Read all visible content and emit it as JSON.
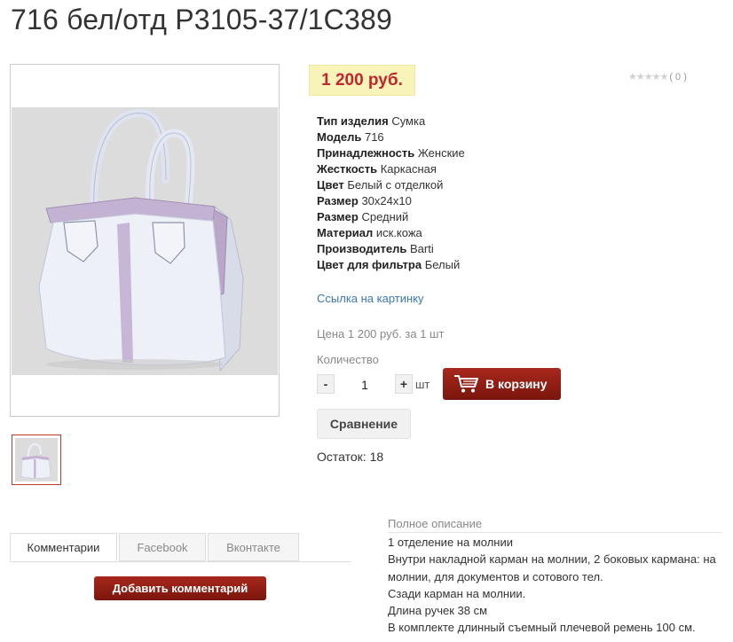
{
  "product": {
    "title": "716 бел/отд Р3105-37/1С389",
    "price": "1 200 руб.",
    "rating": {
      "count_text": "( 0 )",
      "stars": 0
    }
  },
  "properties": [
    {
      "label": "Тип изделия",
      "value": "Сумка"
    },
    {
      "label": "Модель",
      "value": "716"
    },
    {
      "label": "Принадлежность",
      "value": "Женские"
    },
    {
      "label": "Жесткость",
      "value": "Каркасная"
    },
    {
      "label": "Цвет",
      "value": "Белый с отделкой"
    },
    {
      "label": "Размер",
      "value": "30x24x10"
    },
    {
      "label": "Размер",
      "value": "Средний"
    },
    {
      "label": "Материал",
      "value": "иск.кожа"
    },
    {
      "label": "Производитель",
      "value": "Barti"
    },
    {
      "label": "Цвет для фильтра",
      "value": "Белый"
    }
  ],
  "image_link": "Ссылка на картинку",
  "unit_price": "Цена 1 200 руб. за 1 шт",
  "quantity": {
    "label": "Количество",
    "minus": "-",
    "plus": "+",
    "value": "1",
    "unit": "шт"
  },
  "cart_button": "В корзину",
  "compare_button": "Сравнение",
  "stock": "Остаток: 18",
  "tabs": [
    {
      "label": "Комментарии",
      "active": true
    },
    {
      "label": "Facebook",
      "active": false
    },
    {
      "label": "Вконтакте",
      "active": false
    }
  ],
  "add_comment": "Добавить комментарий",
  "description": {
    "title": "Полное описание",
    "lines": [
      "1 отделение на молнии",
      "Внутри накладной карман на молнии, 2 боковых кармана: на молнии, для документов и сотового тел.",
      "Сзади карман на молнии.",
      "Длина ручек 38 см",
      "В комплекте длинный съемный плечевой ремень 100 см."
    ]
  },
  "colors": {
    "price": "#c1272d",
    "price_bg": "#f8f3b8",
    "accent_button": "#8c1d12",
    "link": "#3a78b5"
  }
}
